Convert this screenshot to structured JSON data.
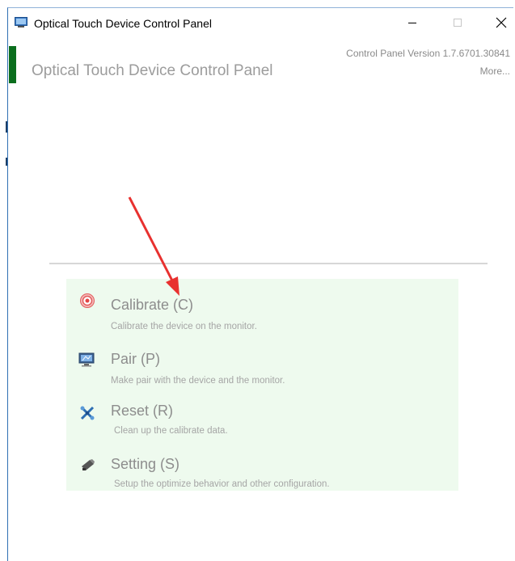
{
  "window": {
    "title": "Optical Touch Device Control Panel"
  },
  "header": {
    "title": "Optical Touch Device Control Panel",
    "version": "Control Panel Version 1.7.6701.30841",
    "more_link": "More..."
  },
  "menu": {
    "items": [
      {
        "label": "Calibrate (C)",
        "description": "Calibrate the device on the monitor.",
        "icon": "target-icon"
      },
      {
        "label": "Pair (P)",
        "description": "Make pair with the device and the monitor.",
        "icon": "monitor-icon"
      },
      {
        "label": "Reset (R)",
        "description": "Clean up the calibrate data.",
        "icon": "reset-icon"
      },
      {
        "label": "Setting (S)",
        "description": "Setup the optimize behavior and other configuration.",
        "icon": "settings-icon"
      }
    ]
  },
  "colors": {
    "accent_green": "#0b6e1d",
    "menu_background": "#eefaee",
    "annotation_arrow": "#e8312f"
  }
}
